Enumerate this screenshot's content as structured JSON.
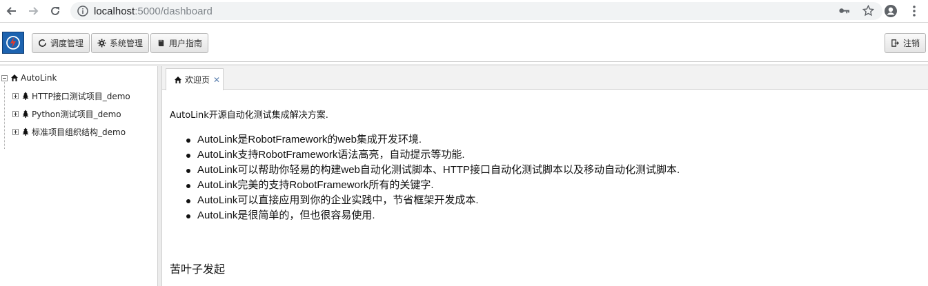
{
  "browser": {
    "url_host": "localhost",
    "url_path": ":5000/dashboard"
  },
  "header": {
    "buttons": [
      {
        "label": "调度管理",
        "icon": "refresh-icon"
      },
      {
        "label": "系统管理",
        "icon": "gear-icon"
      },
      {
        "label": "用户指南",
        "icon": "book-icon"
      }
    ],
    "logout_label": "注销"
  },
  "tree": {
    "root": {
      "label": "AutoLink",
      "icon": "home-icon"
    },
    "projects": [
      {
        "label": "HTTP接口测试项目_demo",
        "icon": "tree-icon"
      },
      {
        "label": "Python测试项目_demo",
        "icon": "tree-icon"
      },
      {
        "label": "标准项目组织结构_demo",
        "icon": "tree-icon"
      }
    ]
  },
  "tabs": [
    {
      "label": "欢迎页",
      "icon": "home-icon",
      "closable": true
    }
  ],
  "welcome": {
    "intro": "AutoLink开源自动化测试集成解决方案.",
    "features": [
      "AutoLink是RobotFramework的web集成开发环境.",
      "AutoLink支持RobotFramework语法高亮，自动提示等功能.",
      "AutoLink可以帮助你轻易的构建web自动化测试脚本、HTTP接口自动化测试脚本以及移动自动化测试脚本.",
      "AutoLink完美的支持RobotFramework所有的关键字.",
      "AutoLink可以直接应用到你的企业实践中，节省框架开发成本.",
      "AutoLink是很简单的，但也很容易使用."
    ],
    "signature": "苦叶子发起"
  },
  "colors": {
    "logo_bg": "#1d63b0",
    "tab_close": "#5b7fae"
  }
}
